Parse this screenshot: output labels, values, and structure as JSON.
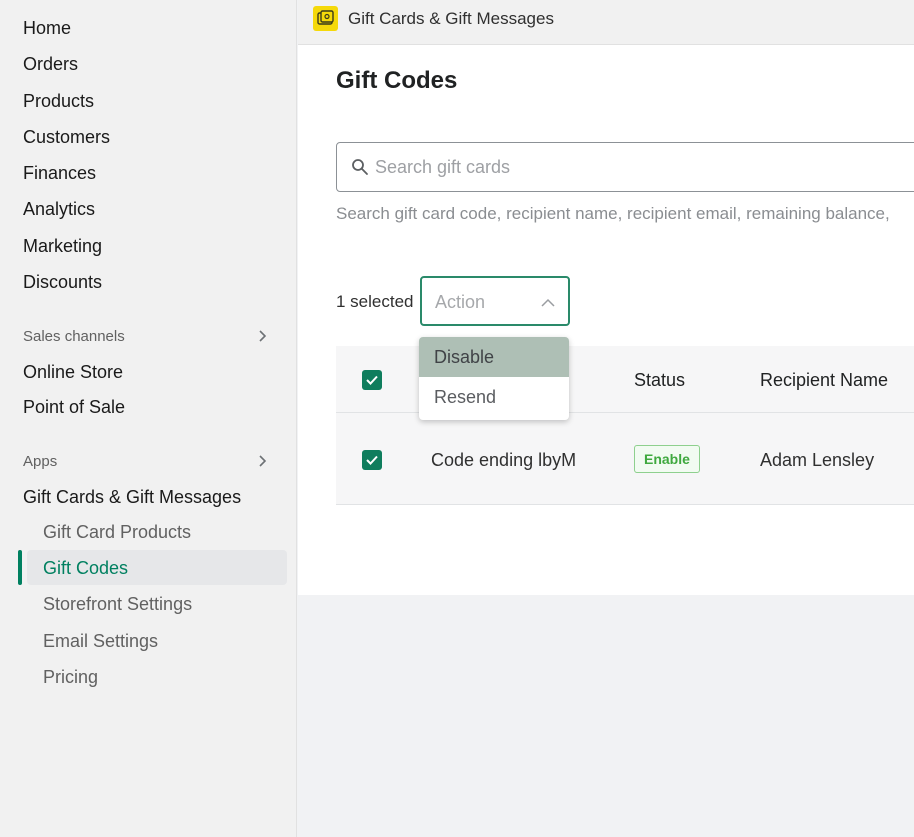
{
  "sidebar": {
    "main_items": [
      {
        "label": "Home"
      },
      {
        "label": "Orders"
      },
      {
        "label": "Products"
      },
      {
        "label": "Customers"
      },
      {
        "label": "Finances"
      },
      {
        "label": "Analytics"
      },
      {
        "label": "Marketing"
      },
      {
        "label": "Discounts"
      }
    ],
    "sales_channels": {
      "label": "Sales channels",
      "items": [
        {
          "label": "Online Store"
        },
        {
          "label": "Point of Sale"
        }
      ]
    },
    "apps": {
      "label": "Apps",
      "app_name": "Gift Cards & Gift Messages",
      "sub_items": [
        {
          "label": "Gift Card Products"
        },
        {
          "label": "Gift Codes"
        },
        {
          "label": "Storefront Settings"
        },
        {
          "label": "Email Settings"
        },
        {
          "label": "Pricing"
        }
      ]
    }
  },
  "topbar": {
    "app_title": "Gift Cards & Gift Messages",
    "icon": "gift-card-app-icon"
  },
  "main": {
    "page_title": "Gift Codes",
    "search": {
      "placeholder": "Search gift cards",
      "value": "",
      "help": "Search gift card code, recipient name, recipient email, remaining balance,"
    },
    "bulk": {
      "selected_label": "1 selected",
      "action_label": "Action",
      "options": [
        {
          "label": "Disable"
        },
        {
          "label": "Resend"
        }
      ]
    },
    "table": {
      "headers": [
        "",
        "Status",
        "Recipient Name"
      ],
      "rows": [
        {
          "code": "Code ending lbyM",
          "status": "Enable",
          "recipient": "Adam Lensley",
          "checked": true
        }
      ]
    }
  },
  "colors": {
    "accent": "#008060",
    "checkbox": "#0f7d5d",
    "app_icon": "#f5d90a",
    "badge_text": "#3fa93f"
  }
}
